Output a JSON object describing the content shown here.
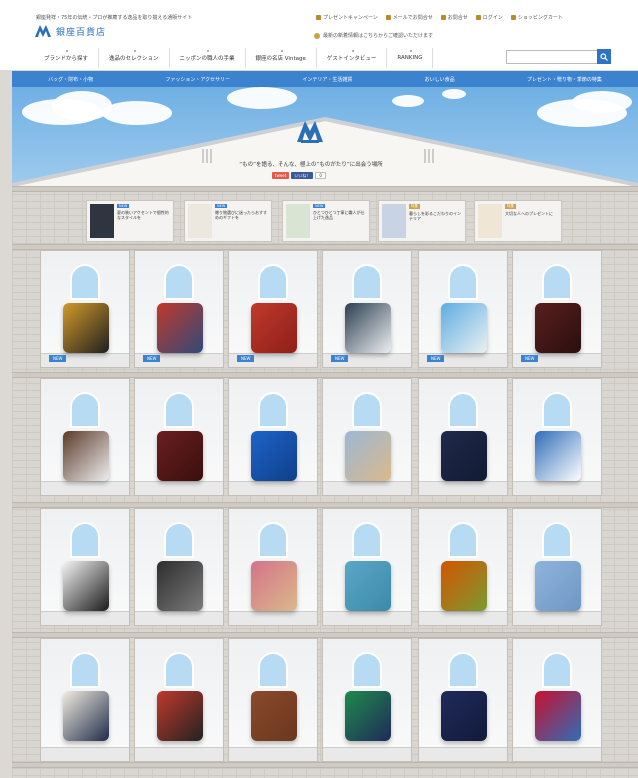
{
  "header": {
    "tagline": "銀座発祥・75年の伝統・プロが推薦する逸品を取り揃える通販サイト",
    "logo_text": "銀座百貨店",
    "top_links": [
      "プレゼントキャンペーン",
      "メールでお問合せ",
      "お問合せ",
      "ログイン",
      "ショッピングカート"
    ],
    "notice": "最新の新着情報はこちらからご確認いただけます",
    "subnav": [
      "ブランドから探す",
      "逸品のセレクション",
      "ニッポンの職人の手業",
      "銀座の名店 Vintage",
      "ゲストインタビュー",
      "RANKING"
    ],
    "search": {
      "placeholder": ""
    }
  },
  "bluenav": [
    "バッグ・財布・小物",
    "ファッション・アクセサリー",
    "インテリア・生活雑貨",
    "おいしい食品",
    "プレゼント・贈り物・季節の特集"
  ],
  "banner": {
    "title": "“もの”を語る、そんな、極上の“ものがたり”に出会う場所",
    "social": [
      "tweet",
      "いいね！",
      "0"
    ]
  },
  "featured": [
    {
      "tag": "NEW",
      "text": "夏の装いアクセントで個性的なスタイルを"
    },
    {
      "tag": "NEW",
      "text": "贈り物選びに迷ったらおすすめのギフトを"
    },
    {
      "tag": "NEW",
      "text": "ひとつひとつ丁寧に職人が仕上げた逸品"
    },
    {
      "tag": "特集",
      "text": "暮らしを彩るこだわりのインテリア"
    },
    {
      "tag": "特集",
      "text": "大切な人へのプレゼントに"
    }
  ],
  "new_badge": "NEW",
  "colors": {
    "accent": "#3b82cf",
    "gold": "#c9a24a",
    "sky": "#8fc3ea"
  },
  "products": [
    "glassware",
    "tie-case",
    "red-bags",
    "wristwatch",
    "bracelet",
    "phone-case",
    "mount-fuji-figure",
    "phone-cases",
    "quilted-jacket",
    "scarf-mannequin",
    "notebook-case",
    "floral-shirt",
    "analog-watch",
    "leather-bracelet",
    "scarf-stand",
    "tote-bag",
    "ceramic-cups",
    "loafers",
    "canvas-tote",
    "handbags",
    "belt",
    "wallets",
    "travel-bag",
    "shorts"
  ]
}
